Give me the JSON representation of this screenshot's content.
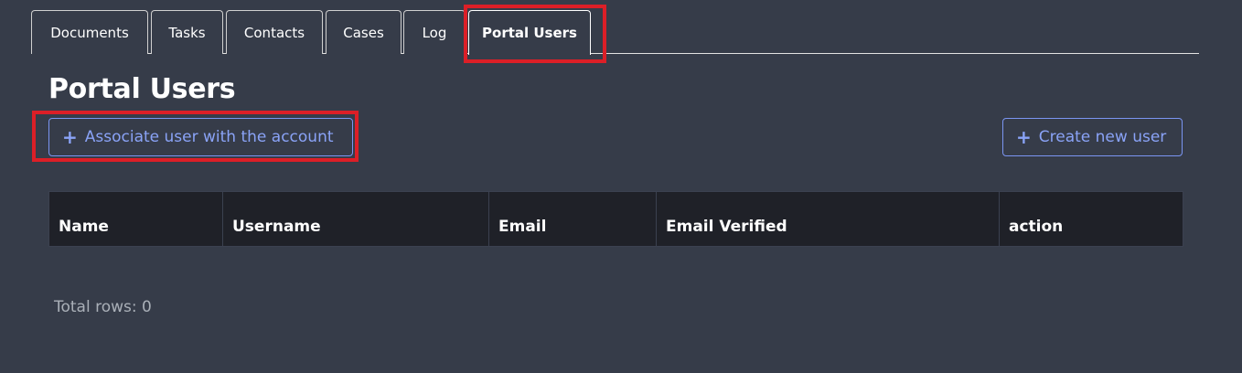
{
  "tabs": [
    {
      "label": "Documents",
      "active": false
    },
    {
      "label": "Tasks",
      "active": false
    },
    {
      "label": "Contacts",
      "active": false
    },
    {
      "label": "Cases",
      "active": false
    },
    {
      "label": "Log",
      "active": false
    },
    {
      "label": "Portal Users",
      "active": true
    }
  ],
  "page_title": "Portal Users",
  "buttons": {
    "associate_label": "Associate user with the account",
    "create_label": "Create new user",
    "icon": "plus-icon"
  },
  "table": {
    "columns": [
      "Name",
      "Username",
      "Email",
      "Email Verified",
      "action"
    ],
    "rows": []
  },
  "footer": {
    "total_rows": "Total rows: 0"
  },
  "colors": {
    "background": "#363c49",
    "table_header": "#1f2128",
    "accent": "#8aa3f7",
    "highlight": "#dc1f27"
  }
}
